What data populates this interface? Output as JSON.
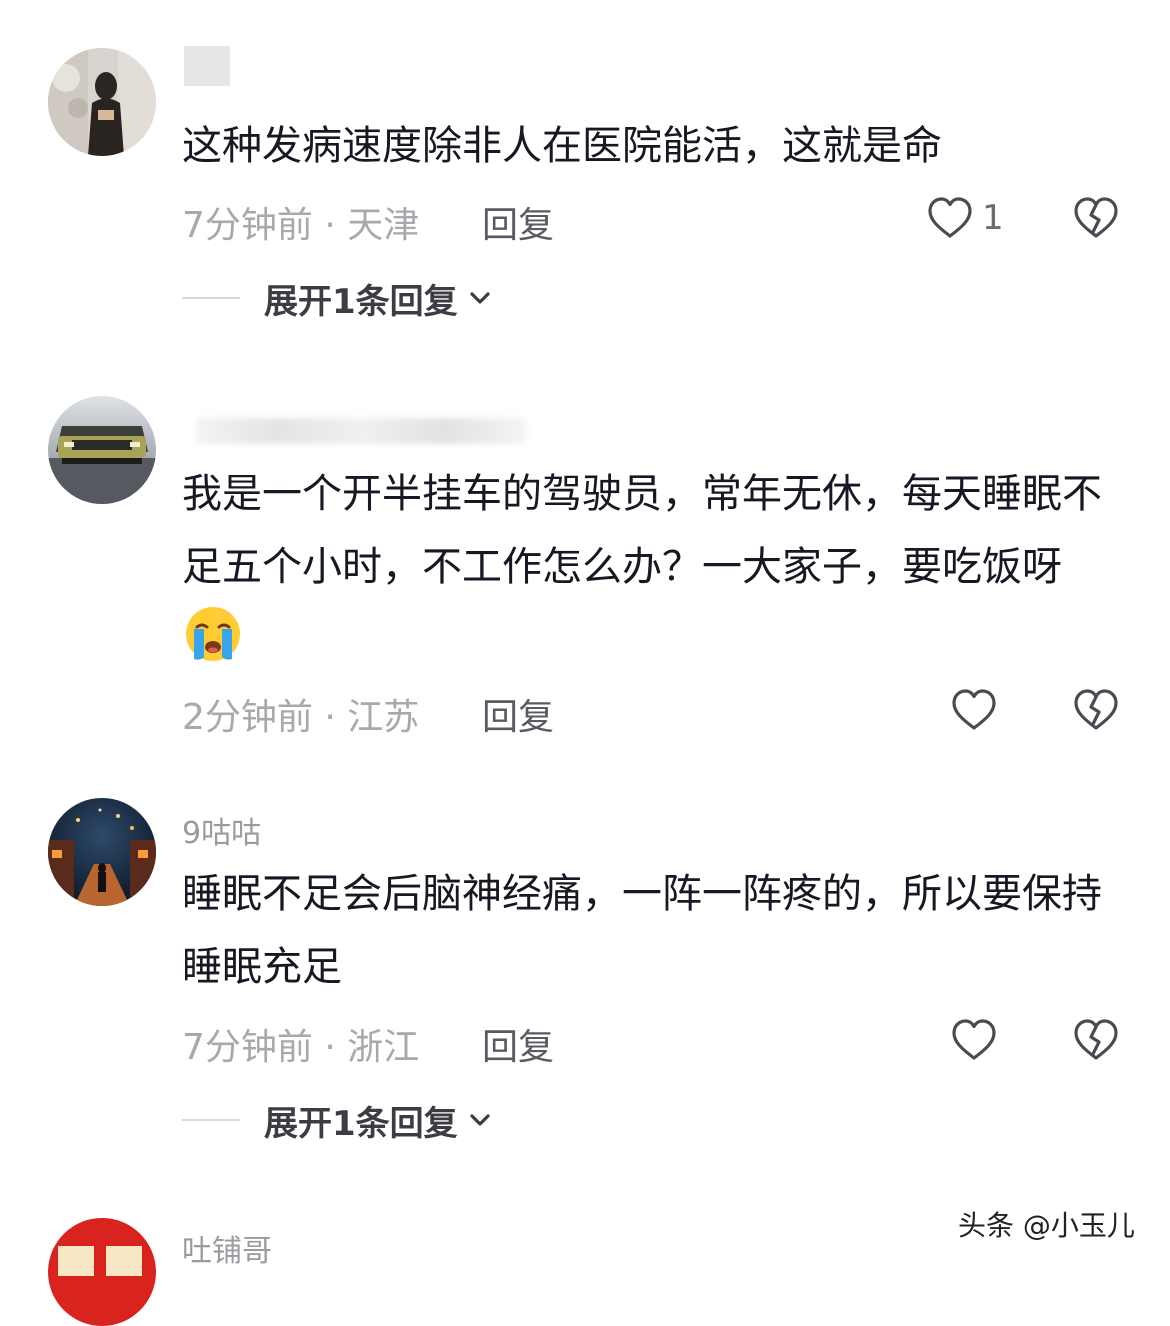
{
  "comments": [
    {
      "username": "",
      "text": "这种发病速度除非人在医院能活，这就是命",
      "time": "7分钟前",
      "location": "天津",
      "reply_label": "回复",
      "likes": "1",
      "expand_label": "展开1条回复"
    },
    {
      "username": "",
      "text": "我是一个开半挂车的驾驶员，常年无休，每天睡眠不足五个小时，不工作怎么办？一大家子，要吃饭呀",
      "emoji": "crying-face-emoji",
      "time": "2分钟前",
      "location": "江苏",
      "reply_label": "回复",
      "likes": ""
    },
    {
      "username": "9咕咕",
      "text": "睡眠不足会后脑神经痛，一阵一阵疼的，所以要保持睡眠充足",
      "time": "7分钟前",
      "location": "浙江",
      "reply_label": "回复",
      "likes": "",
      "expand_label": "展开1条回复"
    },
    {
      "username": "吐铺哥"
    }
  ],
  "meta_separator": "·",
  "icons": {
    "like": "heart-outline-icon",
    "dislike": "broken-heart-icon",
    "expand": "chevron-down-icon"
  },
  "watermark": "头条 @小玉儿"
}
